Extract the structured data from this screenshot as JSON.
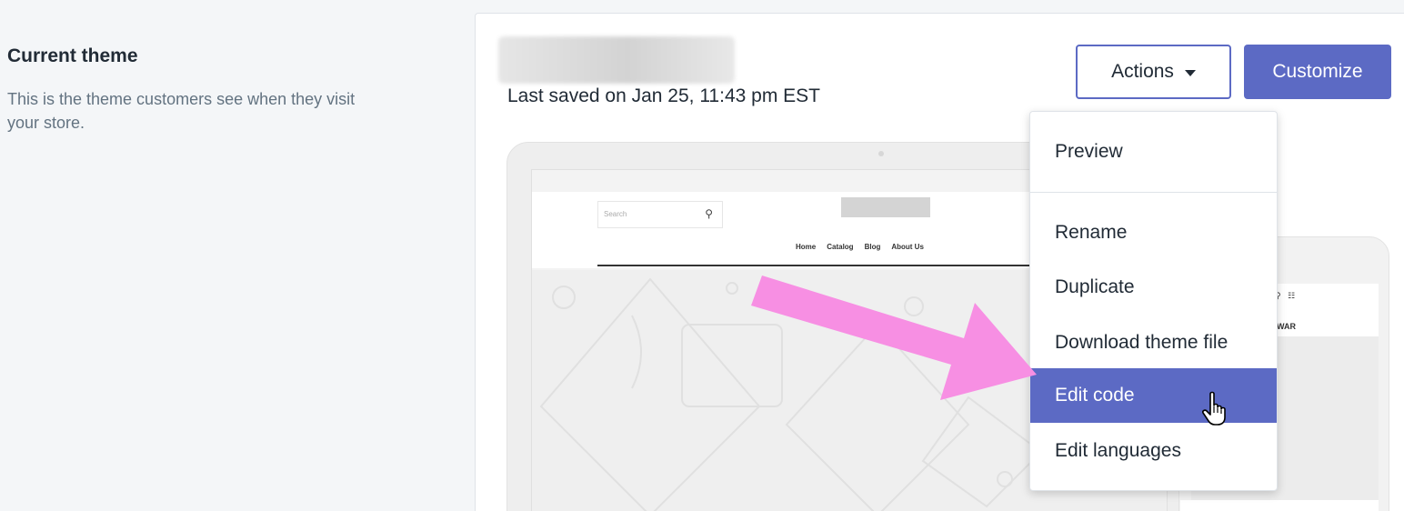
{
  "section": {
    "title": "Current theme",
    "description": "This is the theme customers see when they visit your store."
  },
  "theme": {
    "last_saved": "Last saved on Jan 25, 11:43 pm EST"
  },
  "buttons": {
    "actions": "Actions",
    "customize": "Customize"
  },
  "menu": {
    "items": [
      {
        "label": "Preview"
      },
      {
        "label": "Rename"
      },
      {
        "label": "Duplicate"
      },
      {
        "label": "Download theme file"
      },
      {
        "label": "Edit code",
        "highlighted": true
      },
      {
        "label": "Edit languages"
      }
    ]
  },
  "preview": {
    "search_placeholder": "Search",
    "nav": [
      "Home",
      "Catalog",
      "Blog",
      "About Us"
    ],
    "mobile_text": "EYWAR"
  },
  "colors": {
    "accent": "#5c6ac4",
    "annotation_arrow": "#f78fe3"
  },
  "icons": [
    "caret-down-icon",
    "search-icon",
    "cart-icon",
    "hand-pointer-icon",
    "annotation-arrow-icon"
  ]
}
